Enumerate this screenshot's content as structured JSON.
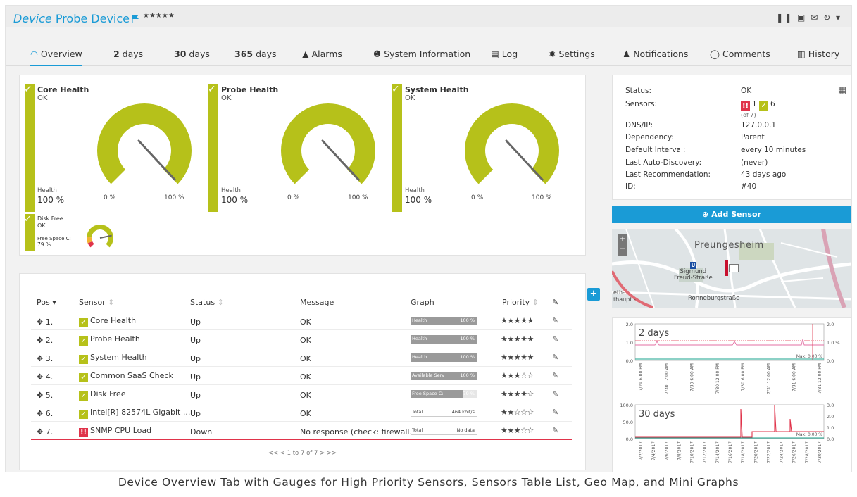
{
  "header": {
    "title_prefix": "Device",
    "title_name": "Probe Device",
    "stars": "★★★★★",
    "icons": [
      "pause-icon",
      "pdf-icon",
      "mail-icon",
      "refresh-icon",
      "dropdown-icon"
    ]
  },
  "tabs": [
    {
      "icon": "◠",
      "label": "Overview"
    },
    {
      "num": "2",
      "label": " days"
    },
    {
      "num": "30",
      "label": " days"
    },
    {
      "num": "365",
      "label": " days"
    },
    {
      "icon": "▲",
      "label": "Alarms"
    },
    {
      "icon": "❶",
      "label": "System Information"
    },
    {
      "icon": "▤",
      "label": "Log"
    },
    {
      "icon": "✹",
      "label": "Settings"
    },
    {
      "icon": "♟",
      "label": "Notifications"
    },
    {
      "icon": "◯",
      "label": "Comments"
    },
    {
      "icon": "▥",
      "label": "History"
    }
  ],
  "gauges": [
    {
      "title": "Core Health",
      "status": "OK",
      "health_label": "Health",
      "health_value": "100 %",
      "min": "0 %",
      "max": "100 %",
      "level": 1.0
    },
    {
      "title": "Probe Health",
      "status": "OK",
      "health_label": "Health",
      "health_value": "100 %",
      "min": "0 %",
      "max": "100 %",
      "level": 1.0
    },
    {
      "title": "System Health",
      "status": "OK",
      "health_label": "Health",
      "health_value": "100 %",
      "min": "0 %",
      "max": "100 %",
      "level": 1.0
    }
  ],
  "small_gauge": {
    "title": "Disk Free",
    "status": "OK",
    "label": "Free Space C:",
    "value": "79 %",
    "level": 0.79
  },
  "table": {
    "headers": {
      "pos": "Pos",
      "sensor": "Sensor",
      "status": "Status",
      "message": "Message",
      "graph": "Graph",
      "priority": "Priority"
    },
    "rows": [
      {
        "pos": "1.",
        "sensor": "Core Health",
        "state": "ok",
        "status": "Up",
        "message": "OK",
        "graph_label": "Health",
        "graph_value": "100 %",
        "fill": 1.0,
        "stars": "★★★★★"
      },
      {
        "pos": "2.",
        "sensor": "Probe Health",
        "state": "ok",
        "status": "Up",
        "message": "OK",
        "graph_label": "Health",
        "graph_value": "100 %",
        "fill": 1.0,
        "stars": "★★★★★"
      },
      {
        "pos": "3.",
        "sensor": "System Health",
        "state": "ok",
        "status": "Up",
        "message": "OK",
        "graph_label": "Health",
        "graph_value": "100 %",
        "fill": 1.0,
        "stars": "★★★★★"
      },
      {
        "pos": "4.",
        "sensor": "Common SaaS Check",
        "state": "ok",
        "status": "Up",
        "message": "OK",
        "graph_label": "Available Serv",
        "graph_value": "100 %",
        "fill": 1.0,
        "stars": "★★★☆☆"
      },
      {
        "pos": "5.",
        "sensor": "Disk Free",
        "state": "ok",
        "status": "Up",
        "message": "OK",
        "graph_label": "Free Space C:",
        "graph_value": "79 %",
        "fill": 0.79,
        "stars": "★★★★☆"
      },
      {
        "pos": "6.",
        "sensor": "Intel[R] 82574L Gigabit ...",
        "state": "ok",
        "status": "Up",
        "message": "OK",
        "graph_label": "Total",
        "graph_value": "464 kbit/s",
        "fill": 0.0,
        "stars": "★★☆☆☆"
      },
      {
        "pos": "7.",
        "sensor": "SNMP CPU Load",
        "state": "down",
        "status": "Down",
        "message": "No response (check: firewall...",
        "graph_label": "Total",
        "graph_value": "No data",
        "fill": 0.0,
        "stars": "★★★☆☆"
      }
    ],
    "pager": "<<  <  1 to 7 of 7  >  >>"
  },
  "info": {
    "rows": [
      {
        "label": "Status:",
        "value": "OK"
      },
      {
        "label": "Sensors:",
        "value": ""
      },
      {
        "label": "DNS/IP:",
        "value": "127.0.0.1"
      },
      {
        "label": "Dependency:",
        "value": "Parent"
      },
      {
        "label": "Default Interval:",
        "value": "every 10 minutes"
      },
      {
        "label": "Last Auto-Discovery:",
        "value": "(never)"
      },
      {
        "label": "Last Recommendation:",
        "value": "43 days ago"
      },
      {
        "label": "ID:",
        "value": "#40"
      }
    ],
    "sensors_down": "1",
    "sensors_up": "6",
    "sensors_of": "(of 7)"
  },
  "add_sensor_label": "Add Sensor",
  "map": {
    "district": "Preungesheim",
    "station": "Sigmund\nFreud-Straße",
    "street1": "Ronneburgstraße",
    "left1": "eth-",
    "left2": "thaupt -"
  },
  "graphs": [
    {
      "label": "2 days",
      "y_left": [
        "2.0",
        "1.0",
        "0.0"
      ],
      "y_right": [
        "2.0",
        "1.0 %",
        "0.0"
      ],
      "max": "Max: 0.00 %",
      "x_ticks": [
        "7/29 6:00 PM",
        "7/30 12:00 AM",
        "7/30 6:00 AM",
        "7/30 12:00 PM",
        "7/30 6:00 PM",
        "7/31 12:00 AM",
        "7/31 6:00 AM",
        "7/31 12:00 PM"
      ]
    },
    {
      "label": "30 days",
      "y_left": [
        "100.0",
        "50.0",
        "0.0"
      ],
      "y_right": [
        "3.0",
        "2.0",
        "1.0",
        "0.0"
      ],
      "max": "Max: 0.00 %",
      "x_ticks": [
        "7/2/2017",
        "7/4/2017",
        "7/6/2017",
        "7/8/2017",
        "7/10/2017",
        "7/12/2017",
        "7/14/2017",
        "7/16/2017",
        "7/18/2017",
        "7/20/2017",
        "7/22/2017",
        "7/24/2017",
        "7/26/2017",
        "7/28/2017",
        "7/30/2017"
      ]
    }
  ],
  "caption": "Device Overview Tab with Gauges for High Priority Sensors, Sensors Table List, Geo Map, and Mini Graphs",
  "colors": {
    "accent": "#1a9bd6",
    "ok": "#b6c11a",
    "error": "#e0334a"
  }
}
